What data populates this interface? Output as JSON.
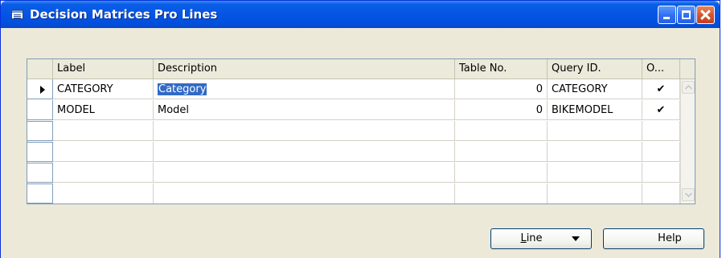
{
  "window": {
    "title": "Decision Matrices Pro Lines"
  },
  "grid": {
    "columns": {
      "label": "Label",
      "description": "Description",
      "table_no": "Table No.",
      "query_id": "Query ID.",
      "o": "O..."
    },
    "rows": [
      {
        "label": "CATEGORY",
        "description": "Category",
        "table_no": "0",
        "query_id": "CATEGORY",
        "o": "✔",
        "current": true
      },
      {
        "label": "MODEL",
        "description": "Model",
        "table_no": "0",
        "query_id": "BIKEMODEL",
        "o": "✔",
        "current": false
      }
    ]
  },
  "buttons": {
    "line_first": "L",
    "line_rest": "ine",
    "help": "Help"
  }
}
